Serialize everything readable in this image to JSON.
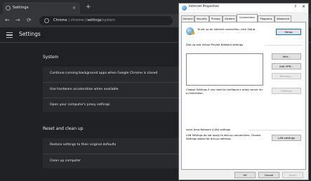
{
  "browser": {
    "tab_title": "Settings",
    "tab_close": "×",
    "new_tab": "+",
    "nav": {
      "back": "←",
      "forward": "→",
      "reload": "⟳"
    },
    "omnibox": {
      "site": "Chrome",
      "separator": " | ",
      "url_scheme": "chrome://",
      "url_host": "settings",
      "url_path": "/system"
    }
  },
  "settings": {
    "title": "Settings",
    "system": {
      "heading": "System",
      "rows": [
        "Continue running background apps when Google Chrome is closed",
        "Use hardware acceleration when available",
        "Open your computer's proxy settings"
      ]
    },
    "reset": {
      "heading": "Reset and clean up",
      "rows": [
        "Restore settings to their original defaults",
        "Clean up computer"
      ]
    }
  },
  "dialog": {
    "title": "Internet Properties",
    "help": "?",
    "close": "×",
    "tabs": [
      "General",
      "Security",
      "Privacy",
      "Content",
      "Connections",
      "Programs",
      "Advanced"
    ],
    "active_tab": "Connections",
    "setup_text": "To set up an Internet connection, click Setup.",
    "setup_button": "Setup",
    "dialup_heading": "Dial-up and Virtual Private Network settings",
    "add_button": "Add...",
    "add_vpn_button": "Add VPN...",
    "remove_button": "Remove...",
    "settings_button": "Settings",
    "proxy_text": "Choose Settings if you need to configure a proxy server for a connection.",
    "lan_heading": "Local Area Network (LAN) settings",
    "lan_text": "LAN Settings do not apply to dial-up connections. Choose Settings above for dial-up settings.",
    "lan_button": "LAN settings",
    "ok_button": "OK",
    "cancel_button": "Cancel",
    "apply_button": "Apply"
  }
}
